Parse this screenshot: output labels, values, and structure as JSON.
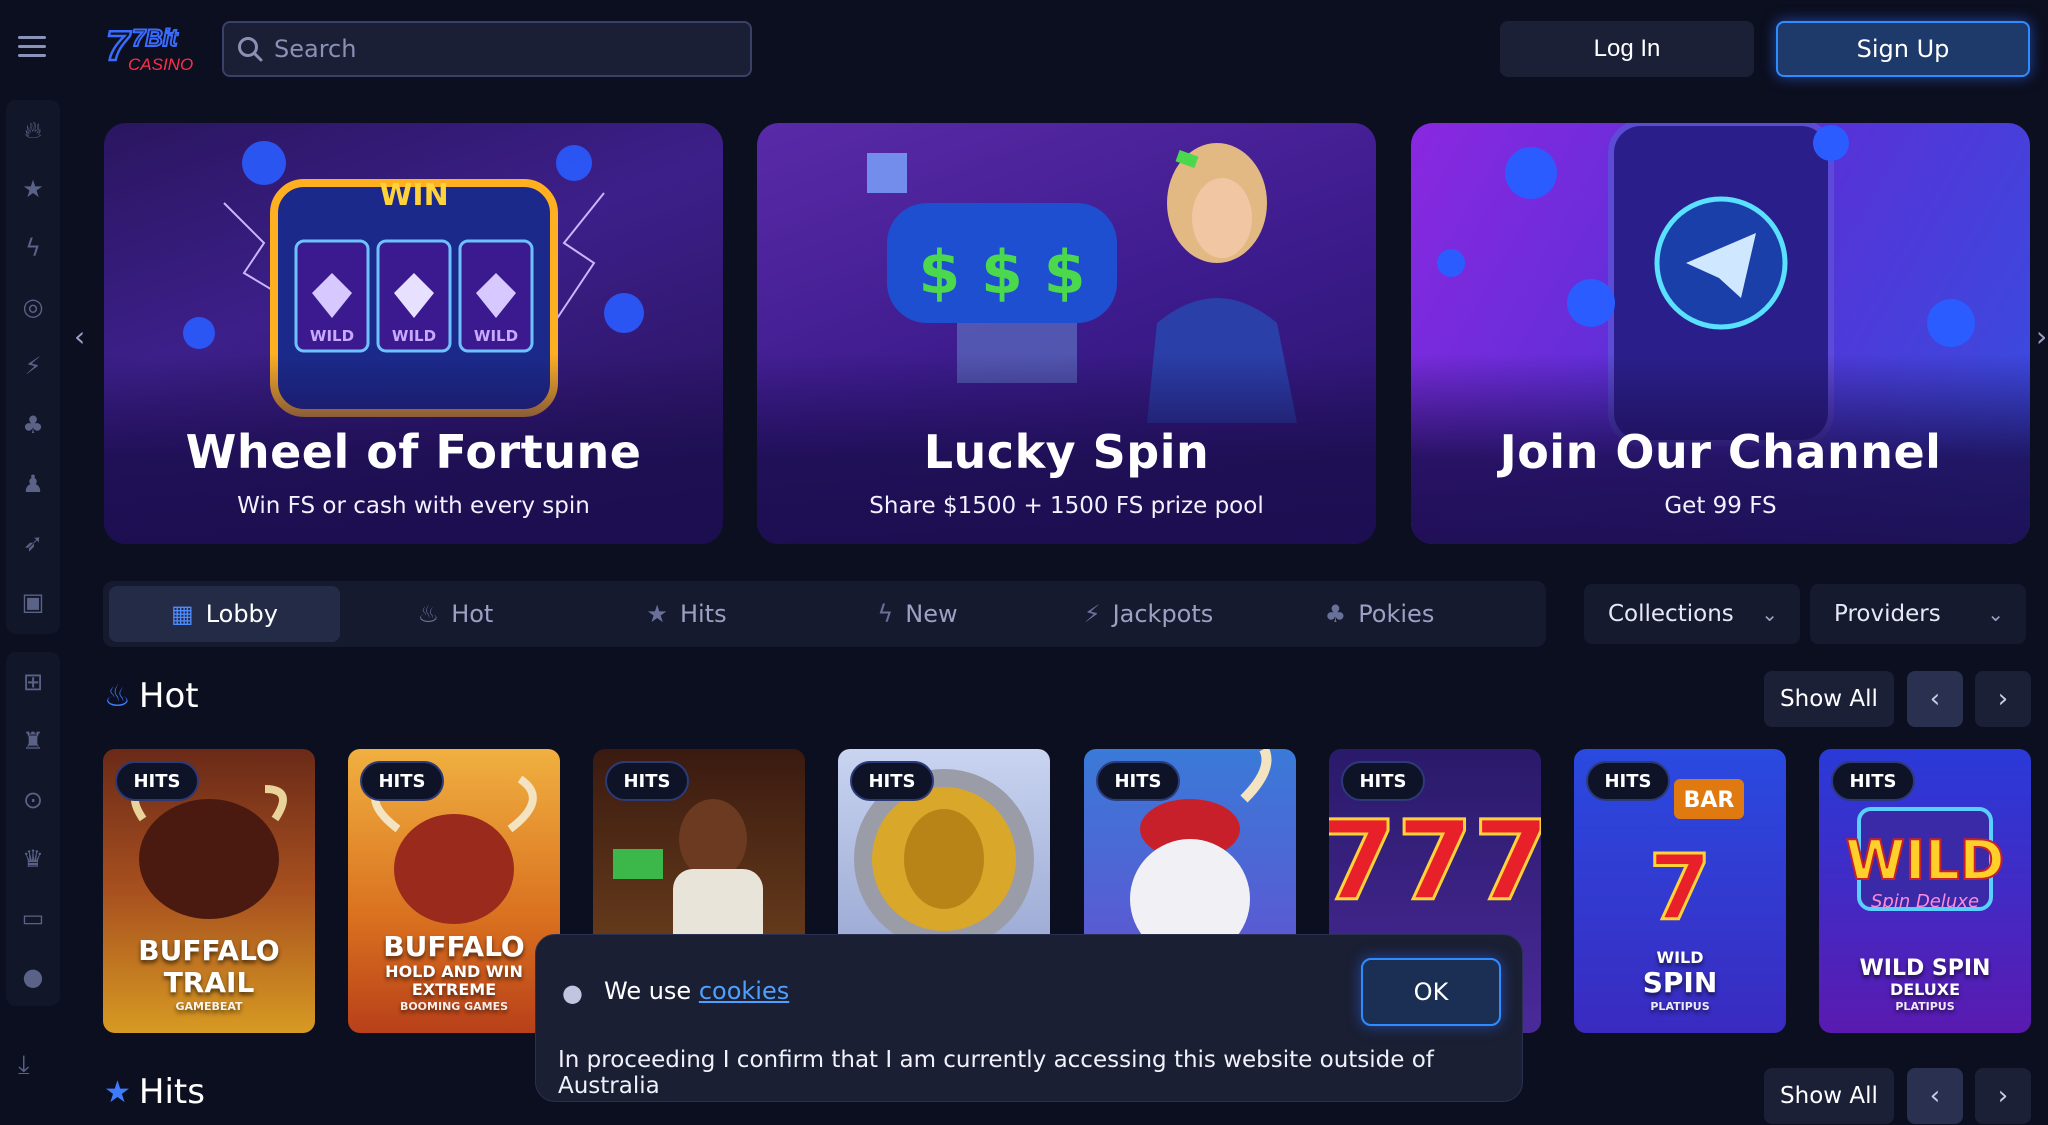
{
  "header": {
    "logo_line1": "7Bit",
    "logo_line2": "CASINO",
    "search_placeholder": "Search",
    "login_label": "Log In",
    "signup_label": "Sign Up"
  },
  "banners": [
    {
      "title": "Wheel of Fortune",
      "subtitle": "Win FS or cash with every spin",
      "art_text": "WIN",
      "reel_text": "WILD"
    },
    {
      "title": "Lucky Spin",
      "subtitle": "Share $1500 + 1500 FS prize pool",
      "art_text": "$ $ $"
    },
    {
      "title": "Join Our Channel",
      "subtitle": "Get 99 FS"
    }
  ],
  "tabs": [
    {
      "label": "Lobby",
      "icon": "slot-machine-icon",
      "active": true
    },
    {
      "label": "Hot",
      "icon": "flame-icon"
    },
    {
      "label": "Hits",
      "icon": "stars-icon"
    },
    {
      "label": "New",
      "icon": "lightning-icon"
    },
    {
      "label": "Jackpots",
      "icon": "jackpot-icon"
    },
    {
      "label": "Pokies",
      "icon": "cherries-icon"
    }
  ],
  "dropdowns": {
    "collections": "Collections",
    "providers": "Providers"
  },
  "sections": {
    "hot": {
      "title": "Hot"
    },
    "hits": {
      "title": "Hits"
    },
    "show_all": "Show All"
  },
  "cards": [
    {
      "badge": "HITS",
      "line1": "BUFFALO",
      "line2": "TRAIL",
      "provider": "GAMEBEAT"
    },
    {
      "badge": "HITS",
      "line1": "BUFFALO",
      "line2": "HOLD AND WIN",
      "line3": "EXTREME",
      "provider": "BOOMING GAMES"
    },
    {
      "badge": "HITS"
    },
    {
      "badge": "HITS"
    },
    {
      "badge": "HITS"
    },
    {
      "badge": "HITS"
    },
    {
      "badge": "HITS",
      "line1": "WILD",
      "line2": "SPIN",
      "provider": "PLATIPUS",
      "sign": "BAR"
    },
    {
      "badge": "HITS",
      "line0": "WILD",
      "line0b": "Spin Deluxe",
      "line1": "WILD SPIN",
      "line2": "DELUXE",
      "provider": "PLATIPUS"
    }
  ],
  "cookie": {
    "prefix": "We use ",
    "link": "cookies",
    "ok_label": "OK",
    "disclaimer": "In proceeding I confirm that I am currently accessing this website outside of Australia"
  }
}
